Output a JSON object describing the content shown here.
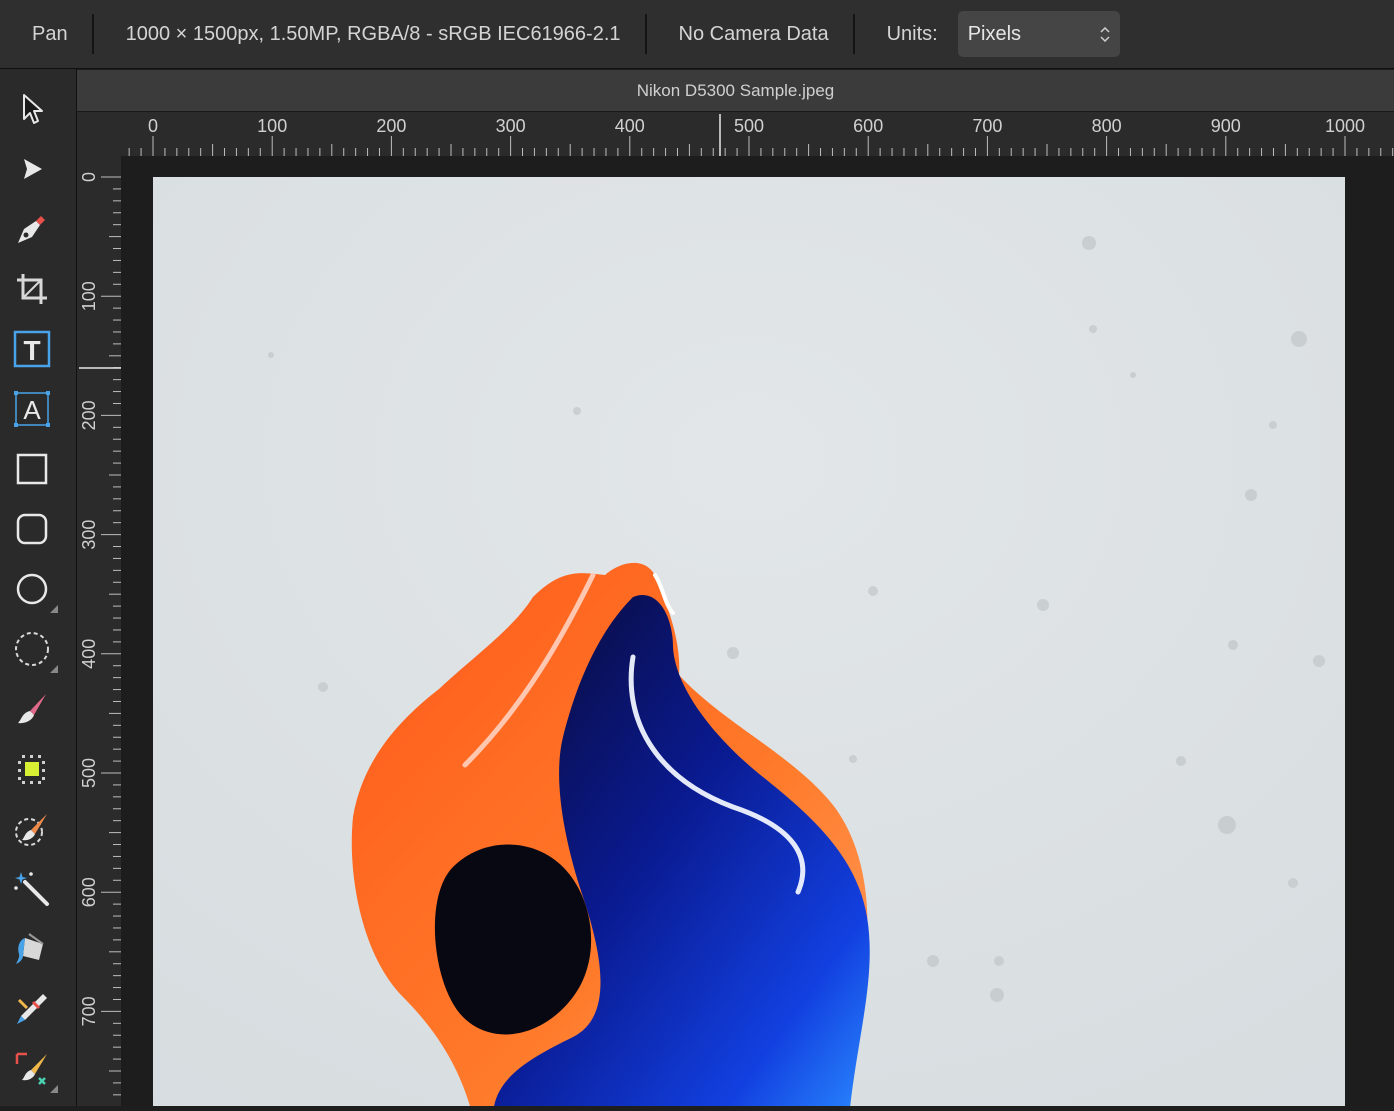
{
  "context_toolbar": {
    "tool_name": "Pan",
    "doc_info": "1000 × 1500px, 1.50MP, RGBA/8 - sRGB IEC61966-2.1",
    "camera_info": "No Camera Data",
    "units_label": "Units:",
    "units_value": "Pixels"
  },
  "document": {
    "tab_title": "Nikon D5300 Sample.jpeg",
    "ruler_unit": "px",
    "h_ruler_labels": [
      "0",
      "100",
      "200",
      "300",
      "400",
      "500",
      "600",
      "700",
      "800",
      "900",
      "1000"
    ],
    "v_ruler_labels": [
      "0",
      "100",
      "200",
      "300",
      "400",
      "500",
      "600",
      "700"
    ]
  },
  "tools": [
    {
      "name": "move-tool",
      "icon": "arrow-pointer-icon"
    },
    {
      "name": "node-tool",
      "icon": "node-arrow-icon"
    },
    {
      "name": "pen-tool",
      "icon": "pen-icon"
    },
    {
      "name": "crop-tool",
      "icon": "crop-icon"
    },
    {
      "name": "frame-text-tool",
      "icon": "frame-text-icon"
    },
    {
      "name": "artistic-text-tool",
      "icon": "artistic-text-icon"
    },
    {
      "name": "rectangle-tool",
      "icon": "rectangle-icon"
    },
    {
      "name": "rounded-rectangle-tool",
      "icon": "rounded-rectangle-icon"
    },
    {
      "name": "ellipse-tool",
      "icon": "ellipse-icon"
    },
    {
      "name": "selection-tool",
      "icon": "dashed-circle-icon"
    },
    {
      "name": "paint-brush-tool",
      "icon": "paint-brush-icon"
    },
    {
      "name": "pixel-tool",
      "icon": "pixel-grid-icon"
    },
    {
      "name": "selection-brush-tool",
      "icon": "selection-brush-icon"
    },
    {
      "name": "magic-wand-tool",
      "icon": "magic-wand-icon"
    },
    {
      "name": "flood-fill-tool",
      "icon": "fill-bucket-icon"
    },
    {
      "name": "clone-tool",
      "icon": "clone-brush-icon"
    },
    {
      "name": "transform-tool",
      "icon": "transform-brush-icon"
    }
  ],
  "colors": {
    "accent_blue": "#4aa3e8",
    "accent_red": "#e8504a",
    "panel": "#2f2f2f"
  }
}
